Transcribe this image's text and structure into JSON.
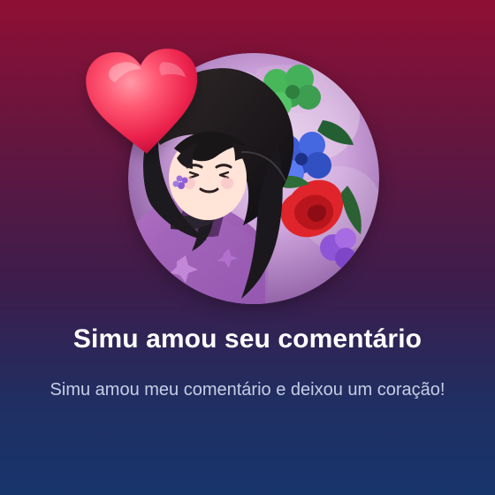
{
  "notification": {
    "title": "Simu amou seu comentário",
    "description": "Simu amou meu comentário e deixou um coração!"
  },
  "visuals": {
    "avatar_icon": "anime-avatar",
    "reaction_icon": "heart-icon",
    "gradient_top": "#8f0f34",
    "gradient_bottom": "#18356b",
    "heart_color": "#ff3d6b"
  }
}
